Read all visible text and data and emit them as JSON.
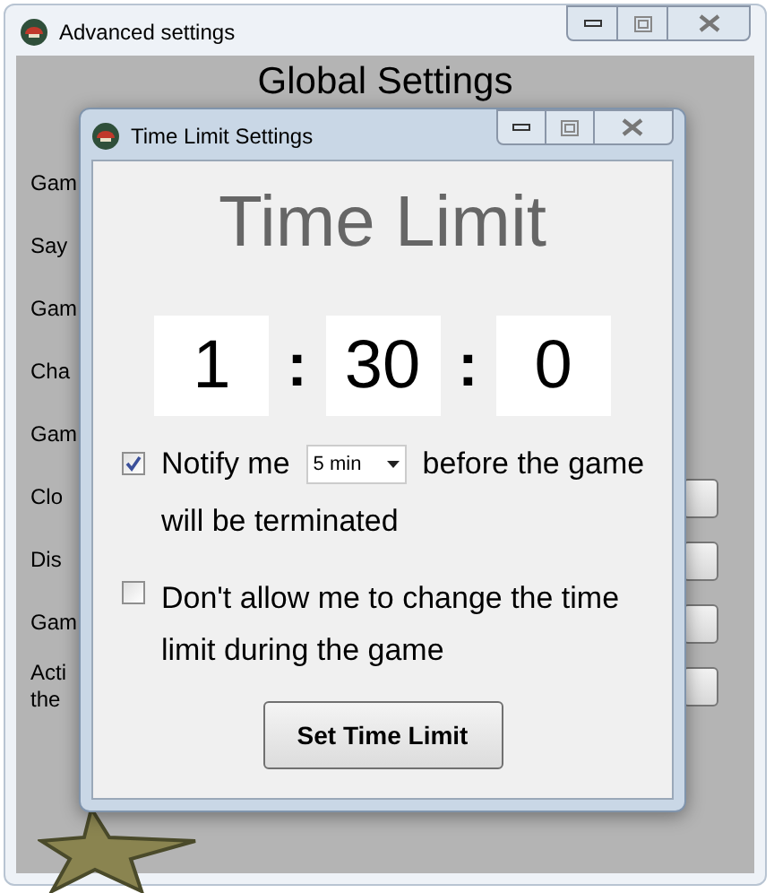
{
  "window": {
    "title": "Advanced settings"
  },
  "heading": "Global Settings",
  "rows": [
    {
      "lines": [
        "Gam"
      ],
      "has_button": false
    },
    {
      "lines": [
        "Say"
      ],
      "has_button": false
    },
    {
      "lines": [
        "Gam"
      ],
      "has_button": false
    },
    {
      "lines": [
        "Cha"
      ],
      "has_button": false
    },
    {
      "lines": [
        "Gam"
      ],
      "has_button": false
    },
    {
      "lines": [
        "Clo"
      ],
      "has_button": true
    },
    {
      "lines": [
        "Dis"
      ],
      "has_button": true
    },
    {
      "lines": [
        "Gam"
      ],
      "has_button": true
    },
    {
      "lines": [
        "Acti",
        "the"
      ],
      "has_button": true
    }
  ],
  "dialog": {
    "title": "Time Limit Settings",
    "heading": "Time Limit",
    "time": [
      "1",
      "30",
      "0"
    ],
    "separators": [
      ":",
      ":"
    ],
    "notify": {
      "checked": true,
      "before": "Notify me",
      "dropdown": "5 min",
      "after": "before the game",
      "line2": "will be terminated"
    },
    "lock": {
      "checked": false,
      "text": "Don't allow me to change the time limit during the game"
    },
    "button": "Set Time Limit"
  }
}
